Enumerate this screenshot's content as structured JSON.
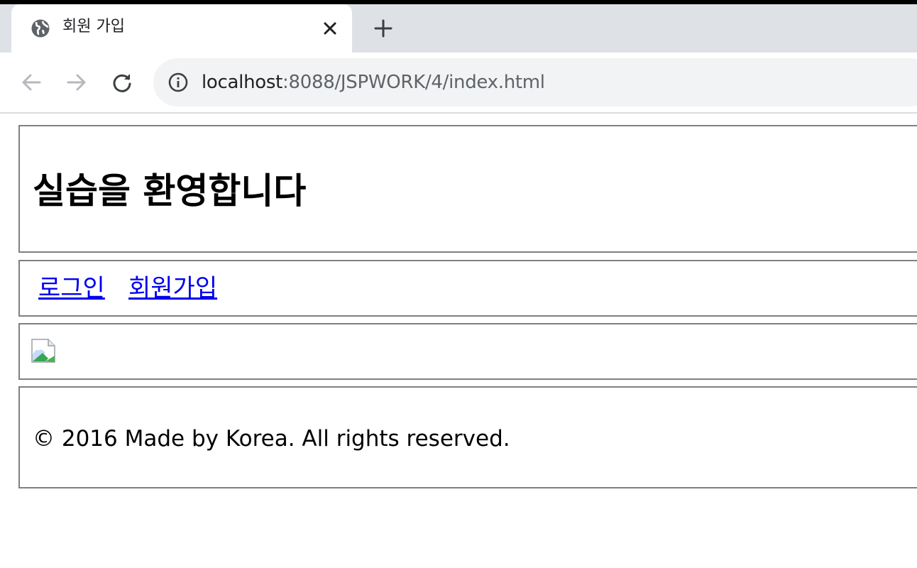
{
  "browser": {
    "tab": {
      "title": "회원 가입",
      "icon": "globe-icon",
      "close_icon": "close-icon"
    },
    "new_tab_icon": "plus-icon",
    "nav": {
      "back_icon": "arrow-left-icon",
      "forward_icon": "arrow-right-icon",
      "reload_icon": "reload-icon"
    },
    "address": {
      "info_icon": "info-icon",
      "host": "localhost",
      "path": ":8088/JSPWORK/4/index.html"
    }
  },
  "page": {
    "header": {
      "title": "실습을 환영합니다"
    },
    "nav": {
      "links": [
        {
          "label": "로그인"
        },
        {
          "label": "회원가입"
        }
      ]
    },
    "image": {
      "icon": "broken-image-icon"
    },
    "footer": {
      "text": "© 2016 Made by Korea. All rights reserved."
    }
  },
  "colors": {
    "link": "#0000ee",
    "border": "#808080",
    "tabbar": "#dee1e6",
    "omnibox": "#f1f3f4"
  }
}
